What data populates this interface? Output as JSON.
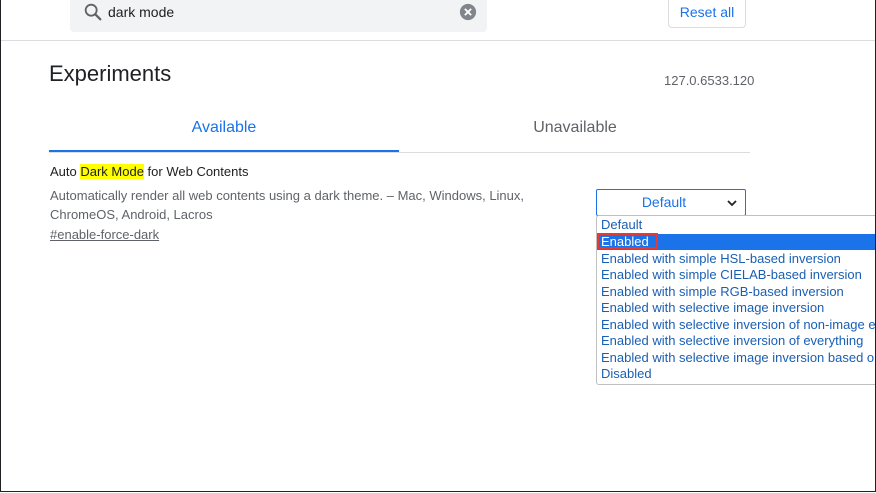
{
  "search": {
    "value": "dark mode",
    "reset_label": "Reset all"
  },
  "page": {
    "title": "Experiments",
    "version": "127.0.6533.120"
  },
  "tabs": [
    {
      "label": "Available"
    },
    {
      "label": "Unavailable"
    }
  ],
  "experiment": {
    "title_before": "Auto ",
    "title_highlight": "Dark Mode",
    "title_after": " for Web Contents",
    "description_line1": "Automatically render all web contents using a dark theme. – Mac, Windows, Linux,",
    "description_line2": "ChromeOS, Android, Lacros",
    "link": "#enable-force-dark"
  },
  "select": {
    "value": "Default",
    "options": [
      "Default",
      "Enabled",
      "Enabled with simple HSL-based inversion",
      "Enabled with simple CIELAB-based inversion",
      "Enabled with simple RGB-based inversion",
      "Enabled with selective image inversion",
      "Enabled with selective inversion of non-image e",
      "Enabled with selective inversion of everything",
      "Enabled with selective image inversion based o",
      "Disabled"
    ],
    "highlighted_option": "Enabled"
  },
  "colors": {
    "accent": "#1a73e8",
    "highlight": "#ffff00",
    "outline": "#e53935"
  }
}
